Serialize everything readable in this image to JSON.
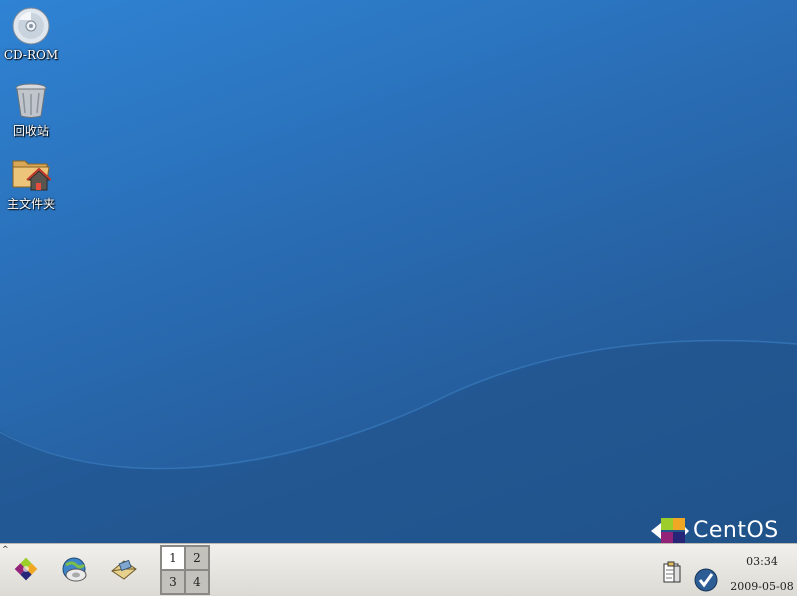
{
  "desktop": {
    "icons": [
      {
        "label": "CD-ROM",
        "icon": "cdrom-icon"
      },
      {
        "label": "回收站",
        "icon": "trash-icon"
      },
      {
        "label": "主文件夹",
        "icon": "home-folder-icon"
      }
    ],
    "branding": "CentOS"
  },
  "taskbar": {
    "menu_arrow": "^",
    "launchers": [
      "main-menu-icon",
      "web-browser-icon",
      "email-icon"
    ],
    "workspaces": [
      {
        "label": "1",
        "active": true
      },
      {
        "label": "2",
        "active": false
      },
      {
        "label": "3",
        "active": false
      },
      {
        "label": "4",
        "active": false
      }
    ],
    "tray": [
      "clipboard-icon",
      "update-check-icon"
    ],
    "clock": "03:34",
    "date": "2009-05-08"
  },
  "colors": {
    "desktop_top": "#2f83d4",
    "desktop_bottom": "#23568f",
    "panel": "#e8e7e2"
  }
}
